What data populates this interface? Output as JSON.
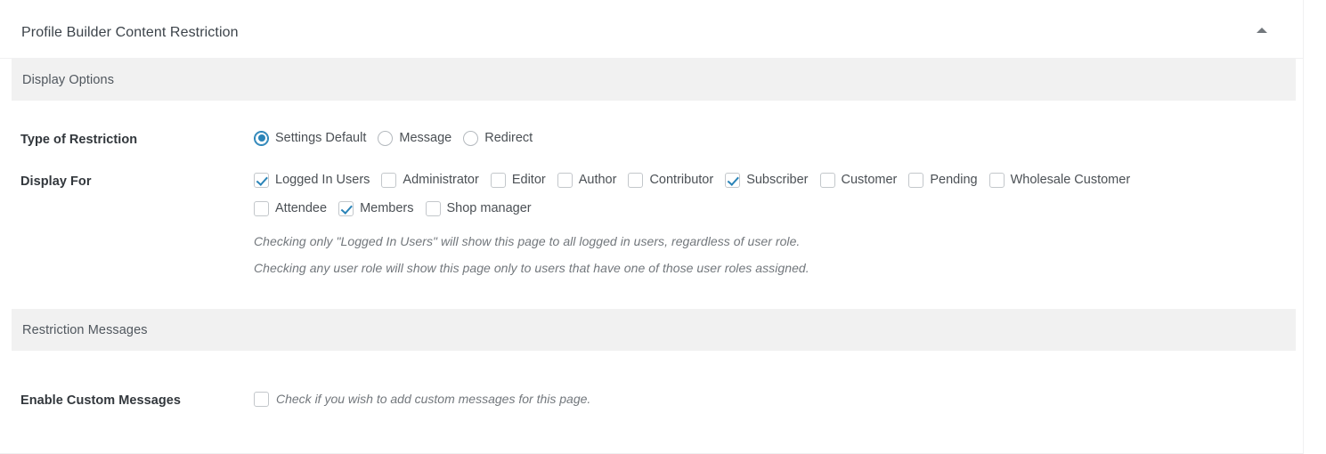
{
  "metabox": {
    "title": "Profile Builder Content Restriction",
    "toggle_icon": "caret-up-icon"
  },
  "sections": [
    {
      "band_title": "Display Options",
      "fields": [
        {
          "label": "Type of Restriction",
          "type": "radio",
          "options": [
            {
              "label": "Settings Default",
              "checked": true
            },
            {
              "label": "Message",
              "checked": false
            },
            {
              "label": "Redirect",
              "checked": false
            }
          ]
        },
        {
          "label": "Display For",
          "type": "checkbox",
          "options": [
            {
              "label": "Logged In Users",
              "checked": true
            },
            {
              "label": "Administrator",
              "checked": false
            },
            {
              "label": "Editor",
              "checked": false
            },
            {
              "label": "Author",
              "checked": false
            },
            {
              "label": "Contributor",
              "checked": false
            },
            {
              "label": "Subscriber",
              "checked": true
            },
            {
              "label": "Customer",
              "checked": false
            },
            {
              "label": "Pending",
              "checked": false
            },
            {
              "label": "Wholesale Customer",
              "checked": false
            },
            {
              "label": "Attendee",
              "checked": false
            },
            {
              "label": "Members",
              "checked": true
            },
            {
              "label": "Shop manager",
              "checked": false
            }
          ],
          "help": [
            "Checking only \"Logged In Users\" will show this page to all logged in users, regardless of user role.",
            "Checking any user role will show this page only to users that have one of those user roles assigned."
          ]
        }
      ]
    },
    {
      "band_title": "Restriction Messages",
      "fields": [
        {
          "label": "Enable Custom Messages",
          "type": "checkbox-inline",
          "checked": false,
          "inline_help": "Check if you wish to add custom messages for this page."
        }
      ]
    }
  ],
  "colors": {
    "accent": "#2a84b8",
    "band_bg": "#f1f1f1",
    "label_text": "#32373c",
    "body_text": "#4b5055",
    "help_text": "#72777c",
    "border": "#f0f0f1"
  }
}
